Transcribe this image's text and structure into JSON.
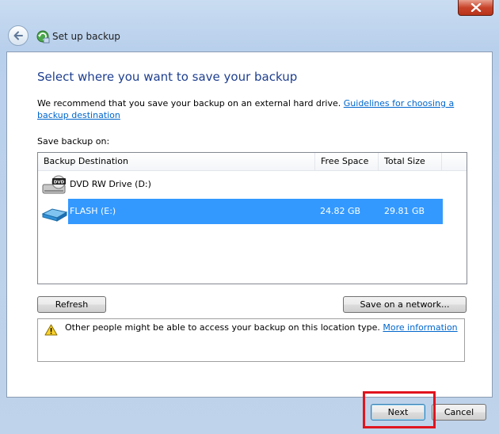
{
  "window": {
    "title": "Set up backup",
    "close_icon": "close-icon",
    "back_icon": "back-arrow-icon",
    "app_icon": "backup-icon"
  },
  "page": {
    "heading": "Select where you want to save your backup",
    "description": "We recommend that you save your backup on an external hard drive.",
    "guidelines_link": "Guidelines for choosing a backup destination",
    "list_label": "Save backup on:"
  },
  "table": {
    "columns": [
      "Backup Destination",
      "Free Space",
      "Total Size"
    ],
    "rows": [
      {
        "icon": "dvd-drive-icon",
        "name": "DVD RW Drive (D:)",
        "free": "",
        "total": "",
        "selected": false
      },
      {
        "icon": "usb-flash-drive-icon",
        "name": "FLASH (E:)",
        "free": "24.82 GB",
        "total": "29.81 GB",
        "selected": true
      }
    ]
  },
  "buttons": {
    "refresh": "Refresh",
    "save_network": "Save on a network...",
    "next": "Next",
    "cancel": "Cancel"
  },
  "warning": {
    "icon": "warning-icon",
    "text": "Other people might be able to access your backup on this location type.",
    "link": "More information"
  },
  "colors": {
    "heading": "#1e3f8f",
    "link": "#0066cc",
    "selection": "#3399ff",
    "highlight": "#e0141e"
  }
}
